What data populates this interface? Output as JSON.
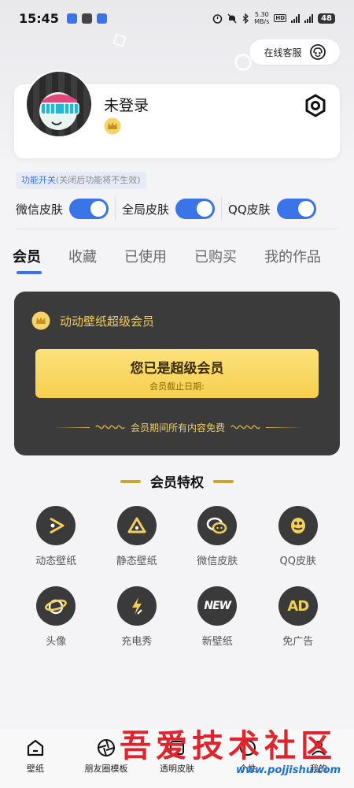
{
  "status_bar": {
    "time": "15:45",
    "net_speed_value": "5.30",
    "net_speed_unit": "MB/s",
    "battery": "48"
  },
  "header": {
    "service_label": "在线客服"
  },
  "profile": {
    "name": "未登录"
  },
  "function_switch": {
    "tag_title": "功能开关",
    "tag_note": "(关闭后功能将不生效)",
    "toggles": [
      {
        "label": "微信皮肤",
        "on": true
      },
      {
        "label": "全局皮肤",
        "on": true
      },
      {
        "label": "QQ皮肤",
        "on": true
      }
    ]
  },
  "tabs": [
    {
      "label": "会员",
      "active": true
    },
    {
      "label": "收藏",
      "active": false
    },
    {
      "label": "已使用",
      "active": false
    },
    {
      "label": "已购买",
      "active": false
    },
    {
      "label": "我的作品",
      "active": false
    }
  ],
  "vip_card": {
    "title": "动动壁纸超级会员",
    "status": "您已是超级会员",
    "expire_label": "会员截止日期:",
    "free_note": "会员期间所有内容免费"
  },
  "privileges": {
    "title": "会员特权",
    "items": [
      {
        "label": "动态壁纸",
        "icon": "play-icon"
      },
      {
        "label": "静态壁纸",
        "icon": "triangle-icon"
      },
      {
        "label": "微信皮肤",
        "icon": "wechat-bubble-icon"
      },
      {
        "label": "QQ皮肤",
        "icon": "qq-penguin-icon"
      },
      {
        "label": "头像",
        "icon": "planet-icon"
      },
      {
        "label": "充电秀",
        "icon": "lightning-icon"
      },
      {
        "label": "新壁纸",
        "icon": "new-badge-icon",
        "icon_text": "NEW"
      },
      {
        "label": "免广告",
        "icon": "ad-free-icon",
        "icon_text": "AD"
      }
    ]
  },
  "bottom_nav": [
    {
      "label": "壁纸",
      "icon": "home-icon"
    },
    {
      "label": "朋友圈模板",
      "icon": "aperture-icon"
    },
    {
      "label": "透明皮肤",
      "icon": "transparent-skin-icon"
    },
    {
      "label": "个性",
      "icon": "personal-icon"
    },
    {
      "label": "我的",
      "icon": "user-icon"
    }
  ],
  "watermark": {
    "text": "吾爱技术社区",
    "url": "www.pojjishu.com"
  },
  "colors": {
    "accent": "#3a74e8",
    "gold": "#f2cf5b",
    "card_dark": "#3b3b3b",
    "watermark_red": "#e0242d"
  }
}
